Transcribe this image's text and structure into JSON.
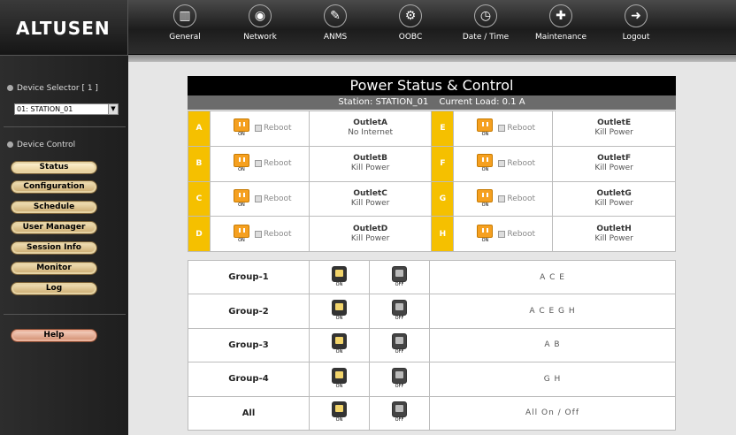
{
  "header": {
    "logo": "ALTUSEN",
    "nav": [
      {
        "label": "General",
        "icon": "general-icon",
        "glyph": "▥"
      },
      {
        "label": "Network",
        "icon": "network-icon",
        "glyph": "◉"
      },
      {
        "label": "ANMS",
        "icon": "anms-icon",
        "glyph": "✎"
      },
      {
        "label": "OOBC",
        "icon": "oobc-icon",
        "glyph": "⚙"
      },
      {
        "label": "Date / Time",
        "icon": "clock-icon",
        "glyph": "◷"
      },
      {
        "label": "Maintenance",
        "icon": "maintenance-icon",
        "glyph": "✚"
      },
      {
        "label": "Logout",
        "icon": "logout-icon",
        "glyph": "➜"
      }
    ]
  },
  "sidebar": {
    "device_selector_label": "Device Selector [ 1 ]",
    "device_selected": "01: STATION_01",
    "device_control_label": "Device Control",
    "menu": [
      "Status",
      "Configuration",
      "Schedule",
      "User Manager",
      "Session Info",
      "Monitor",
      "Log"
    ],
    "help": "Help"
  },
  "power": {
    "title": "Power Status & Control",
    "station": "Station: STATION_01",
    "load": "Current Load: 0.1 A",
    "on_label": "ON",
    "off_label": "OFF",
    "reboot_label": "Reboot",
    "outlets": [
      {
        "letter": "A",
        "name": "OutletA",
        "status": "No Internet"
      },
      {
        "letter": "B",
        "name": "OutletB",
        "status": "Kill Power"
      },
      {
        "letter": "C",
        "name": "OutletC",
        "status": "Kill Power"
      },
      {
        "letter": "D",
        "name": "OutletD",
        "status": "Kill Power"
      },
      {
        "letter": "E",
        "name": "OutletE",
        "status": "Kill Power"
      },
      {
        "letter": "F",
        "name": "OutletF",
        "status": "Kill Power"
      },
      {
        "letter": "G",
        "name": "OutletG",
        "status": "Kill Power"
      },
      {
        "letter": "H",
        "name": "OutletH",
        "status": "Kill Power"
      }
    ]
  },
  "groups": [
    {
      "name": "Group-1",
      "members": "A C E"
    },
    {
      "name": "Group-2",
      "members": "A C E G H"
    },
    {
      "name": "Group-3",
      "members": "A B"
    },
    {
      "name": "Group-4",
      "members": "G H"
    },
    {
      "name": "All",
      "members": "All On / Off"
    }
  ]
}
